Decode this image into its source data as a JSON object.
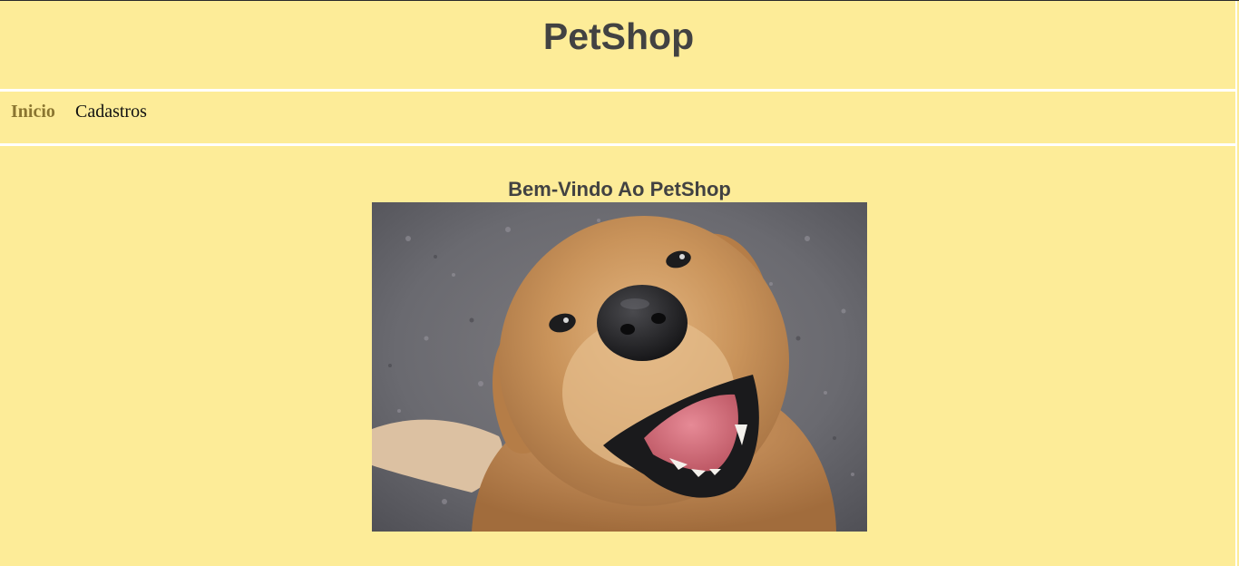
{
  "header": {
    "title": "PetShop"
  },
  "nav": {
    "items": [
      {
        "label": "Inicio",
        "active": true
      },
      {
        "label": "Cadastros",
        "active": false
      }
    ]
  },
  "main": {
    "welcome": "Bem-Vindo Ao PetShop",
    "image": {
      "subject": "golden-retriever-photo",
      "alt": ""
    }
  },
  "colors": {
    "background": "#fdec98",
    "title_text": "#424242",
    "active_nav": "#8a7530",
    "divider": "#ffffff"
  }
}
